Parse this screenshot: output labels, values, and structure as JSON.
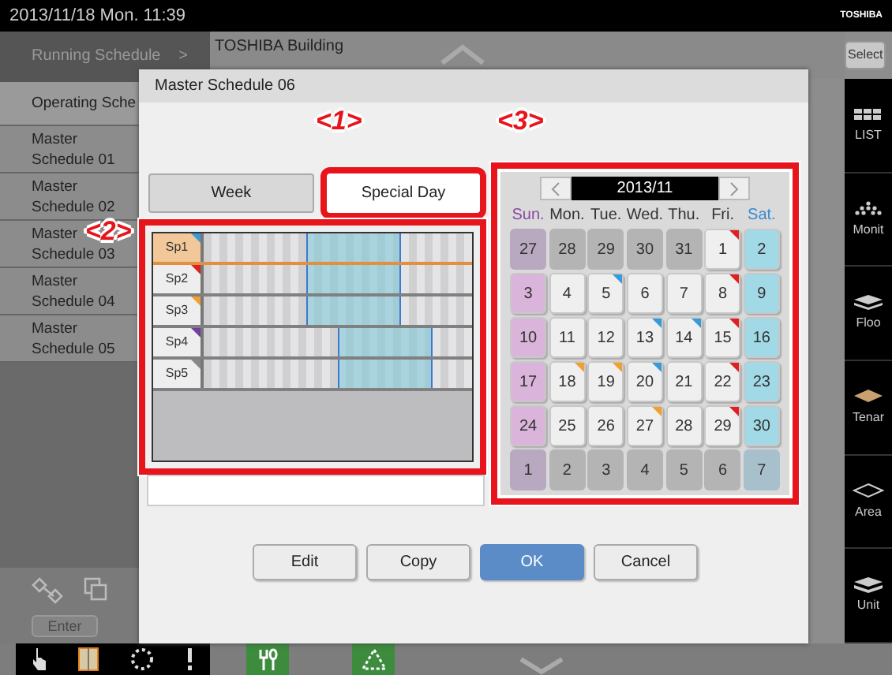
{
  "status_bar": {
    "datetime": "2013/11/18  Mon.  11:39",
    "brand": "TOSHIBA"
  },
  "sidebar": {
    "header": "Running Schedule",
    "header_arrow": ">",
    "items": [
      {
        "label": "Operating Sche",
        "selected": true
      },
      {
        "label": "Master Schedule 01",
        "selected": false
      },
      {
        "label": "Master Schedule 02",
        "selected": false
      },
      {
        "label": "Master Schedule 03",
        "selected": false
      },
      {
        "label": "Master Schedule 04",
        "selected": false
      },
      {
        "label": "Master Schedule 05",
        "selected": false
      }
    ],
    "enter_button": "Enter"
  },
  "header": {
    "building": "TOSHIBA Building",
    "select_button": "Select"
  },
  "right_nav": [
    {
      "label": "LIST"
    },
    {
      "label": "Monit"
    },
    {
      "label": "Floo"
    },
    {
      "label": "Tenar"
    },
    {
      "label": "Area"
    },
    {
      "label": "Unit"
    }
  ],
  "dialog": {
    "title": "Master Schedule 06",
    "callouts": [
      "<1>",
      "<2>",
      "<3>"
    ],
    "tabs": [
      {
        "label": "Week",
        "selected": false
      },
      {
        "label": "Special Day",
        "selected": true
      }
    ],
    "special_days": [
      {
        "label": "Sp1",
        "selected": true,
        "color": "#3a9ad8"
      },
      {
        "label": "Sp2",
        "selected": false,
        "color": "#e02020"
      },
      {
        "label": "Sp3",
        "selected": false,
        "color": "#f0a030"
      },
      {
        "label": "Sp4",
        "selected": false,
        "color": "#7040a0"
      },
      {
        "label": "Sp5",
        "selected": false,
        "color": "#888888"
      }
    ],
    "calendar": {
      "month": "2013/11",
      "weekdays": [
        "Sun.",
        "Mon.",
        "Tue.",
        "Wed.",
        "Thu.",
        "Fri.",
        "Sat."
      ],
      "days": [
        {
          "day": "27",
          "other_month": true
        },
        {
          "day": "28",
          "other_month": true
        },
        {
          "day": "29",
          "other_month": true
        },
        {
          "day": "30",
          "other_month": true
        },
        {
          "day": "31",
          "other_month": true
        },
        {
          "day": "1",
          "other_month": false,
          "color": "#e02020"
        },
        {
          "day": "2",
          "other_month": false
        },
        {
          "day": "3",
          "other_month": false
        },
        {
          "day": "4",
          "other_month": false
        },
        {
          "day": "5",
          "other_month": false,
          "color": "#3a9ad8"
        },
        {
          "day": "6",
          "other_month": false
        },
        {
          "day": "7",
          "other_month": false
        },
        {
          "day": "8",
          "other_month": false,
          "color": "#e02020"
        },
        {
          "day": "9",
          "other_month": false
        },
        {
          "day": "10",
          "other_month": false
        },
        {
          "day": "11",
          "other_month": false
        },
        {
          "day": "12",
          "other_month": false
        },
        {
          "day": "13",
          "other_month": false,
          "color": "#3a9ad8"
        },
        {
          "day": "14",
          "other_month": false,
          "color": "#3a9ad8"
        },
        {
          "day": "15",
          "other_month": false,
          "color": "#e02020"
        },
        {
          "day": "16",
          "other_month": false
        },
        {
          "day": "17",
          "other_month": false
        },
        {
          "day": "18",
          "other_month": false,
          "color": "#f0a030"
        },
        {
          "day": "19",
          "other_month": false,
          "color": "#f0a030"
        },
        {
          "day": "20",
          "other_month": false,
          "color": "#3a9ad8"
        },
        {
          "day": "21",
          "other_month": false
        },
        {
          "day": "22",
          "other_month": false,
          "color": "#e02020"
        },
        {
          "day": "23",
          "other_month": false
        },
        {
          "day": "24",
          "other_month": false
        },
        {
          "day": "25",
          "other_month": false
        },
        {
          "day": "26",
          "other_month": false
        },
        {
          "day": "27",
          "other_month": false,
          "color": "#f0a030"
        },
        {
          "day": "28",
          "other_month": false
        },
        {
          "day": "29",
          "other_month": false,
          "color": "#e02020"
        },
        {
          "day": "30",
          "other_month": false
        },
        {
          "day": "1",
          "other_month": true
        },
        {
          "day": "2",
          "other_month": true
        },
        {
          "day": "3",
          "other_month": true
        },
        {
          "day": "4",
          "other_month": true
        },
        {
          "day": "5",
          "other_month": true
        },
        {
          "day": "6",
          "other_month": true
        },
        {
          "day": "7",
          "other_month": true
        }
      ]
    },
    "buttons": [
      {
        "label": "Edit",
        "kind": "plain"
      },
      {
        "label": "Copy",
        "kind": "plain"
      },
      {
        "label": "OK",
        "kind": "primary"
      },
      {
        "label": "Cancel",
        "kind": "plain"
      }
    ]
  }
}
